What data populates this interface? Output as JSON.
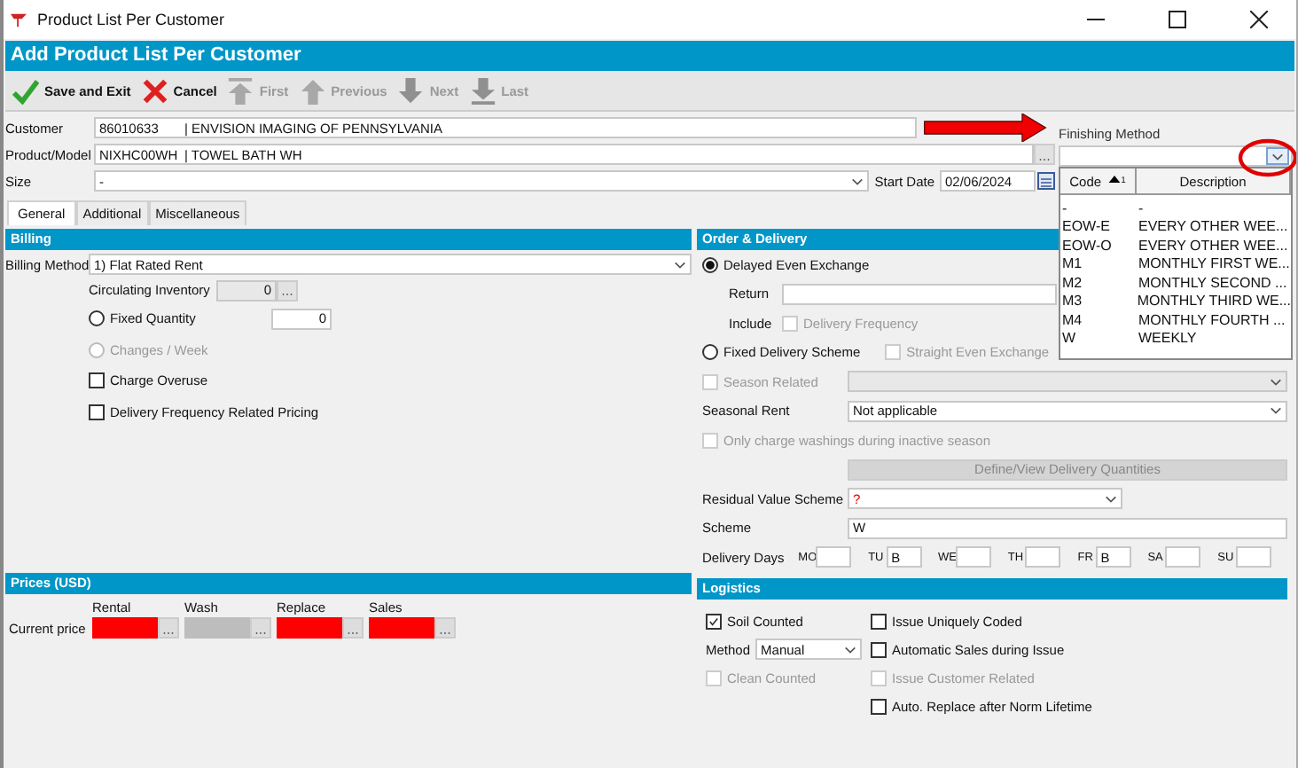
{
  "window": {
    "title": "Product List Per Customer"
  },
  "header": {
    "title": "Add Product List Per Customer"
  },
  "toolbar": [
    {
      "kind": "save",
      "label": "Save and Exit",
      "disabled": false
    },
    {
      "kind": "cancel",
      "label": "Cancel",
      "disabled": false
    },
    {
      "kind": "first",
      "label": "First",
      "disabled": true
    },
    {
      "kind": "previous",
      "label": "Previous",
      "disabled": true
    },
    {
      "kind": "next",
      "label": "Next",
      "disabled": true
    },
    {
      "kind": "last",
      "label": "Last",
      "disabled": true
    }
  ],
  "customer": {
    "label": "Customer",
    "code": "86010633",
    "name": "| ENVISION IMAGING OF PENNSYLVANIA"
  },
  "product": {
    "label": "Product/Model",
    "code": "NIXHC00WH",
    "name": "| TOWEL BATH WH"
  },
  "size": {
    "label": "Size",
    "value": "-"
  },
  "start_date": {
    "label": "Start Date",
    "value": "02/06/2024"
  },
  "finishing_method": {
    "label": "Finishing Method",
    "list": {
      "columns": [
        {
          "label": "Code",
          "sorted": true,
          "sort_order": "1"
        },
        {
          "label": "Description",
          "sorted": false
        }
      ],
      "rows": [
        {
          "code": "-",
          "description": "-"
        },
        {
          "code": "EOW-E",
          "description": "EVERY OTHER WEE..."
        },
        {
          "code": "EOW-O",
          "description": "EVERY OTHER WEE..."
        },
        {
          "code": "M1",
          "description": "MONTHLY FIRST WE..."
        },
        {
          "code": "M2",
          "description": "MONTHLY SECOND ..."
        },
        {
          "code": "M3",
          "description": "MONTHLY THIRD WE..."
        },
        {
          "code": "M4",
          "description": "MONTHLY FOURTH ..."
        },
        {
          "code": "W",
          "description": "WEEKLY"
        }
      ]
    }
  },
  "tabs": [
    {
      "label": "General",
      "selected": true
    },
    {
      "label": "Additional",
      "selected": false
    },
    {
      "label": "Miscellaneous",
      "selected": false
    }
  ],
  "billing": {
    "title": "Billing",
    "method_label": "Billing Method",
    "method": "1) Flat Rated Rent",
    "circulating_label": "Circulating Inventory",
    "circulating_value": "0",
    "options": [
      {
        "kind": "radio",
        "label": "Fixed Quantity",
        "selected": false,
        "disabled": false,
        "value": "0"
      },
      {
        "kind": "radio",
        "label": "Changes / Week",
        "selected": false,
        "disabled": true
      },
      {
        "kind": "checkbox",
        "label": "Charge Overuse",
        "checked": false,
        "disabled": false
      },
      {
        "kind": "checkbox",
        "label": "Delivery Frequency Related Pricing",
        "checked": false,
        "disabled": false
      }
    ]
  },
  "prices": {
    "title": "Prices (USD)",
    "row_label": "Current price",
    "columns": [
      {
        "label": "Rental",
        "required": true,
        "disabled": false
      },
      {
        "label": "Wash",
        "required": false,
        "disabled": true
      },
      {
        "label": "Replace",
        "required": true,
        "disabled": false
      },
      {
        "label": "Sales",
        "required": true,
        "disabled": false
      }
    ]
  },
  "order_delivery": {
    "title": "Order & Delivery",
    "delayed_even_exchange": {
      "kind": "radio",
      "label": "Delayed Even Exchange",
      "selected": true,
      "disabled": false
    },
    "return": {
      "label": "Return"
    },
    "include": {
      "label": "Include",
      "option": {
        "kind": "checkbox",
        "label": "Delivery Frequency",
        "checked": false,
        "disabled": true
      }
    },
    "fixed_delivery_scheme": {
      "kind": "radio",
      "label": "Fixed Delivery Scheme",
      "selected": false,
      "disabled": false
    },
    "straight_even_exchange": {
      "kind": "checkbox",
      "label": "Straight Even Exchange",
      "checked": false,
      "disabled": true
    },
    "season_related": {
      "kind": "checkbox",
      "label": "Season Related",
      "checked": false,
      "disabled": true
    },
    "seasonal_rent": {
      "label": "Seasonal Rent",
      "value": "Not applicable"
    },
    "only_charge": {
      "kind": "checkbox",
      "label": "Only charge washings during inactive season",
      "checked": false,
      "disabled": true
    },
    "define_button": {
      "label": "Define/View Delivery Quantities",
      "disabled": true
    },
    "residual_value_scheme": {
      "label": "Residual Value Scheme",
      "value": "?"
    },
    "scheme": {
      "label": "Scheme",
      "value": "W"
    },
    "delivery_days": {
      "label": "Delivery Days",
      "days": [
        {
          "label": "MO"
        },
        {
          "label": "TU",
          "value": "B"
        },
        {
          "label": "WE"
        },
        {
          "label": "TH"
        },
        {
          "label": "FR",
          "value": "B"
        },
        {
          "label": "SA"
        },
        {
          "label": "SU"
        }
      ]
    }
  },
  "logistics": {
    "title": "Logistics",
    "left": [
      {
        "kind": "checkbox",
        "label": "Soil Counted",
        "checked": true,
        "disabled": false
      },
      {
        "kind": "select",
        "label": "Method",
        "value": "Manual"
      },
      {
        "kind": "checkbox",
        "label": "Clean Counted",
        "checked": false,
        "disabled": true
      }
    ],
    "right": [
      {
        "kind": "checkbox",
        "label": "Issue Uniquely Coded",
        "checked": false,
        "disabled": false
      },
      {
        "kind": "checkbox",
        "label": "Automatic Sales during Issue",
        "checked": false,
        "disabled": false
      },
      {
        "kind": "checkbox",
        "label": "Issue Customer Related",
        "checked": false,
        "disabled": true
      },
      {
        "kind": "checkbox",
        "label": "Auto. Replace after Norm Lifetime",
        "checked": false,
        "disabled": false
      }
    ]
  }
}
